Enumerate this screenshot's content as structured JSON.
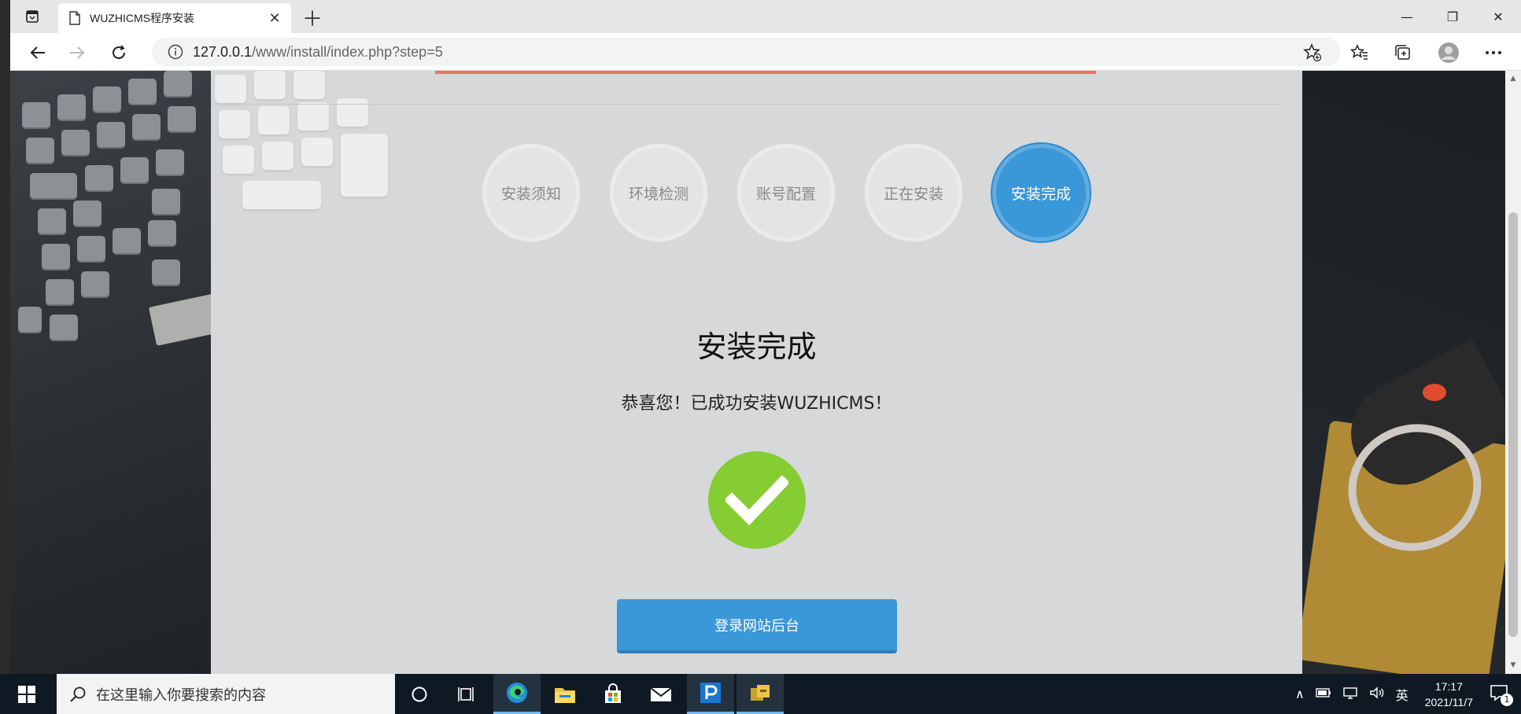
{
  "browser": {
    "tab_title": "WUZHICMS程序安装",
    "url_host": "127.0.0.1",
    "url_path": "/www/install/index.php?step=5"
  },
  "steps": [
    {
      "label": "安装须知",
      "active": false
    },
    {
      "label": "环境检测",
      "active": false
    },
    {
      "label": "账号配置",
      "active": false
    },
    {
      "label": "正在安装",
      "active": false
    },
    {
      "label": "安装完成",
      "active": true
    }
  ],
  "main": {
    "title": "安装完成",
    "message": "恭喜您！已成功安装WUZHICMS！",
    "login_button": "登录网站后台"
  },
  "taskbar": {
    "search_placeholder": "在这里输入你要搜索的内容",
    "ime": "英",
    "time": "17:17",
    "date": "2021/11/7",
    "notification_count": "1"
  },
  "colors": {
    "accent_blue": "#3a97d8",
    "success_green": "#85cd32",
    "progress_red": "#e8736b"
  }
}
